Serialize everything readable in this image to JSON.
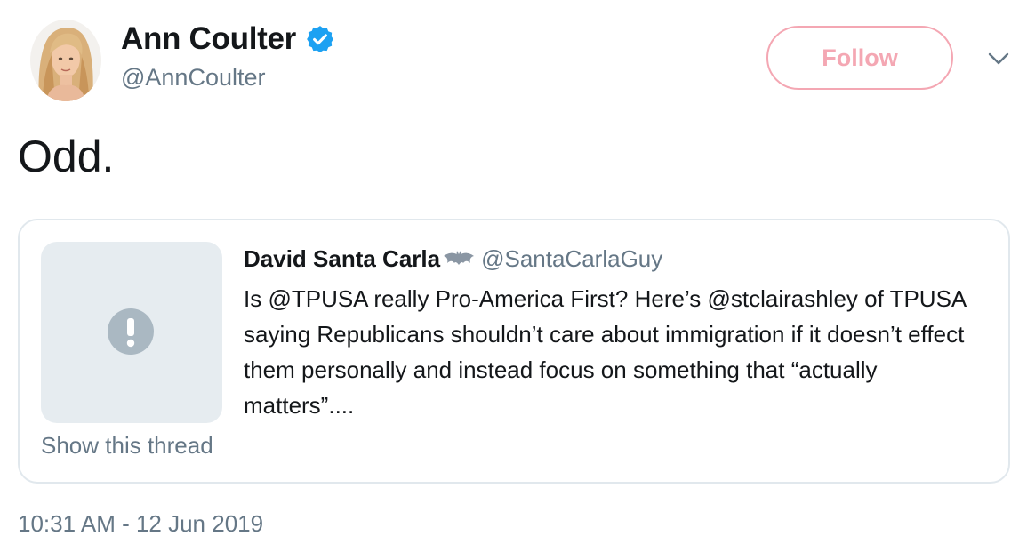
{
  "author": {
    "display_name": "Ann Coulter",
    "handle": "@AnnCoulter",
    "verified": true,
    "avatar_icon": "profile-photo"
  },
  "follow_button": {
    "label": "Follow",
    "color": "#f4a7b3"
  },
  "menu": {
    "icon": "chevron-down-icon"
  },
  "tweet": {
    "text": "Odd."
  },
  "quoted_tweet": {
    "author_name": "David Santa Carla",
    "author_emoji_icon": "bat-icon",
    "author_handle": "@SantaCarlaGuy",
    "text": "Is @TPUSA really Pro-America First? Here’s @stclairashley of TPUSA saying Republicans shouldn’t care about immigration if it doesn’t effect them personally and instead focus on something that “actually matters”....",
    "media_icon": "alert-icon",
    "show_thread_label": "Show this thread"
  },
  "timestamp": "10:31 AM - 12 Jun 2019",
  "colors": {
    "text_primary": "#14171a",
    "text_secondary": "#657786",
    "verified_blue": "#1da1f2",
    "border": "#e1e8ed",
    "placeholder_bg": "#e6ecf0"
  }
}
